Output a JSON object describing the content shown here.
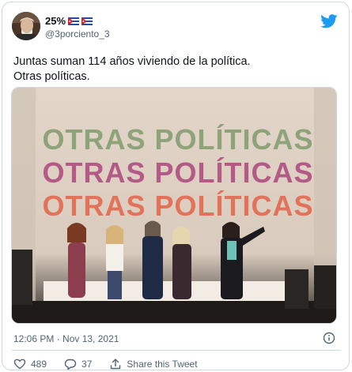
{
  "user": {
    "display_name": "25%",
    "handle": "@3porciento_3",
    "avatar": "avatar-photo"
  },
  "tweet": {
    "lines": [
      "Juntas suman 114 años viviendo de la política.",
      "Otras políticas."
    ],
    "timestamp": "12:06 PM · Nov 13, 2021"
  },
  "media": {
    "banner_lines": [
      "OTRAS POLÍTICAS",
      "OTRAS POLÍTICAS",
      "OTRAS POLÍTICAS"
    ],
    "banner_colors": [
      "#8ea37a",
      "#b35a86",
      "#e2735a"
    ]
  },
  "actions": {
    "like_count": "489",
    "reply_count": "37",
    "share_label": "Share this Tweet"
  },
  "colors": {
    "brand": "#1d9bf0",
    "secondary_text": "#536471",
    "border": "#cfd9de"
  }
}
